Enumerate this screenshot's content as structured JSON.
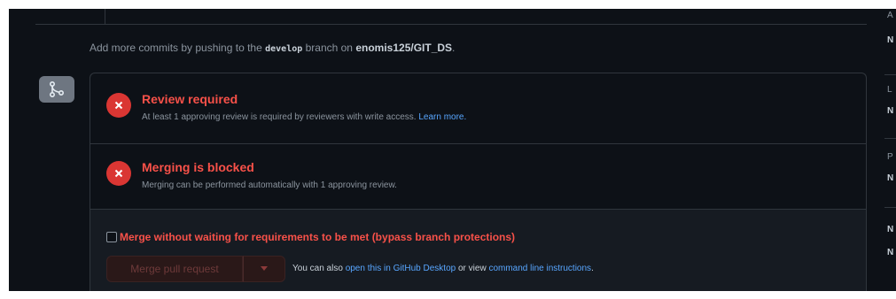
{
  "hint": {
    "prefix": "Add more commits by pushing to the",
    "branch": "develop",
    "middle": "branch on",
    "repo": "enomis125/GIT_DS",
    "suffix": "."
  },
  "icons": {
    "merge": "git-merge-icon",
    "error": "x-circle-icon",
    "dropdown": "triangle-down-icon"
  },
  "review": {
    "title": "Review required",
    "desc": "At least 1 approving review is required by reviewers with write access.",
    "learn_more": "Learn more."
  },
  "blocked": {
    "title": "Merging is blocked",
    "desc": "Merging can be performed automatically with 1 approving review."
  },
  "bypass": {
    "label": "Merge without waiting for requirements to be met (bypass branch protections)",
    "checked": false
  },
  "merge": {
    "button_label": "Merge pull request",
    "also_prefix": "You can also",
    "desktop_link": "open this in GitHub Desktop",
    "or_view": "or view",
    "cli_link": "command line instructions",
    "suffix": "."
  },
  "sidebar": {
    "letters": [
      "A",
      "N",
      "L",
      "N",
      "P",
      "N",
      "N",
      "N"
    ]
  },
  "colors": {
    "background": "#0d1117",
    "danger": "#f85149",
    "danger_bg": "#da3633",
    "link": "#58a6ff",
    "muted": "#8b949e",
    "border": "#30363d"
  }
}
